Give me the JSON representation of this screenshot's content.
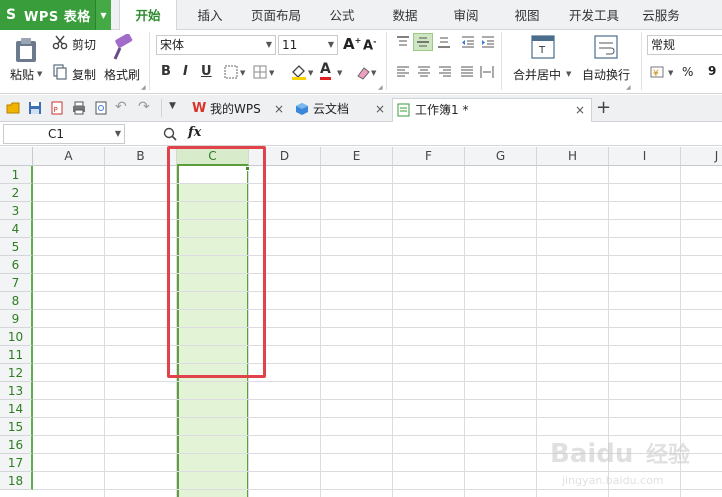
{
  "app": {
    "title": "WPS 表格"
  },
  "menu": {
    "tabs": [
      {
        "label": "开始",
        "active": true
      },
      {
        "label": "插入"
      },
      {
        "label": "页面布局"
      },
      {
        "label": "公式"
      },
      {
        "label": "数据"
      },
      {
        "label": "审阅"
      },
      {
        "label": "视图"
      },
      {
        "label": "开发工具"
      },
      {
        "label": "云服务"
      }
    ]
  },
  "ribbon": {
    "paste": "粘贴",
    "cut": "剪切",
    "copy": "复制",
    "format_painter": "格式刷",
    "font_name": "宋体",
    "font_size": "11",
    "bold": "B",
    "italic": "I",
    "underline": "U",
    "merge_center": "合并居中",
    "wrap_text": "自动换行",
    "number_format": "常规",
    "percent": "%",
    "comma": "9"
  },
  "doc_tabs": [
    {
      "label": "我的WPS"
    },
    {
      "label": "云文档"
    },
    {
      "label": "工作簿1 *",
      "active": true
    }
  ],
  "formula_bar": {
    "cell_ref": "C1",
    "fx": "fx"
  },
  "grid": {
    "columns": [
      "A",
      "B",
      "C",
      "D",
      "E",
      "F",
      "G",
      "H",
      "I",
      "J"
    ],
    "selected_column": "C",
    "rows": [
      "1",
      "2",
      "3",
      "4",
      "5",
      "6",
      "7",
      "8",
      "9",
      "10",
      "11",
      "12",
      "13",
      "14",
      "15",
      "16",
      "17",
      "18"
    ]
  },
  "watermark": {
    "brand": "Baidu",
    "text": "经验",
    "url": "jingyan.baidu.com"
  },
  "colors": {
    "accent_green": "#3a9d3b",
    "selection_fill": "#e3f3d6",
    "highlight_red": "#e0444a"
  }
}
